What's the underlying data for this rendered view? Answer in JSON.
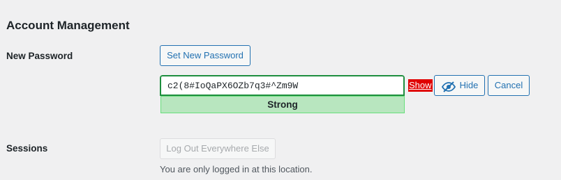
{
  "section": {
    "title": "Account Management"
  },
  "new_password": {
    "label": "New Password",
    "set_button_label": "Set New Password",
    "password_value": "c2(8#IoQaPX6OZb7q3#^Zm9W",
    "strength_label": "Strong",
    "show_label": "Show",
    "hide_button_label": "Hide",
    "cancel_button_label": "Cancel",
    "hide_icon": "eye-slash-icon"
  },
  "sessions": {
    "label": "Sessions",
    "logout_button_label": "Log Out Everywhere Else",
    "description": "You are only logged in at this location."
  },
  "colors": {
    "page_background": "#f0f0f1",
    "accent": "#2271b1",
    "strong_bg": "#b8e6bf",
    "strong_border": "#68de7c",
    "input_focus_border": "#1e8e3e",
    "show_highlight": "#e00000"
  }
}
